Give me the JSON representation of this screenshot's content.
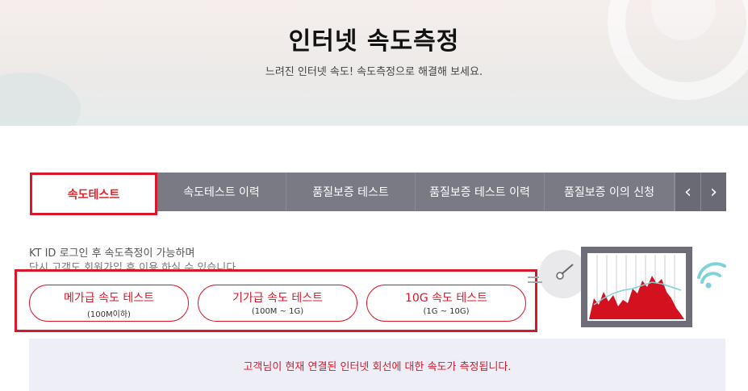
{
  "hero": {
    "title": "인터넷 속도측정",
    "subtitle": "느려진 인터넷 속도! 속도측정으로 해결해 보세요."
  },
  "tabs": [
    {
      "label": "속도테스트",
      "active": true
    },
    {
      "label": "속도테스트 이력",
      "active": false
    },
    {
      "label": "품질보증 테스트",
      "active": false
    },
    {
      "label": "품질보증 테스트 이력",
      "active": false
    },
    {
      "label": "품질보증 이의 신청",
      "active": false
    }
  ],
  "tab_nav": {
    "prev_icon": "chevron-left-icon",
    "next_icon": "chevron-right-icon",
    "prev": "‹",
    "next": "›"
  },
  "notice": {
    "line1": "KT ID 로그인 후 속도측정이 가능하며",
    "line2": "단시 고객도 회원가입 후 이용 하실 수 있습니다."
  },
  "speed_tests": [
    {
      "label": "메가급 속도 테스트",
      "range": "(100M이하)"
    },
    {
      "label": "기가급 속도 테스트",
      "range": "(100M ~ 1G)"
    },
    {
      "label": "10G 속도 테스트",
      "range": "(1G ~ 10G)"
    }
  ],
  "info_bar": {
    "text": "고객님이 현재 연결된 인터넷 회선에 대한 속도가 측정됩니다."
  },
  "colors": {
    "accent": "#d8182a",
    "tab_bg": "#7a7a85",
    "info_bg": "#eeeef7",
    "wifi": "#7fd3d6"
  }
}
